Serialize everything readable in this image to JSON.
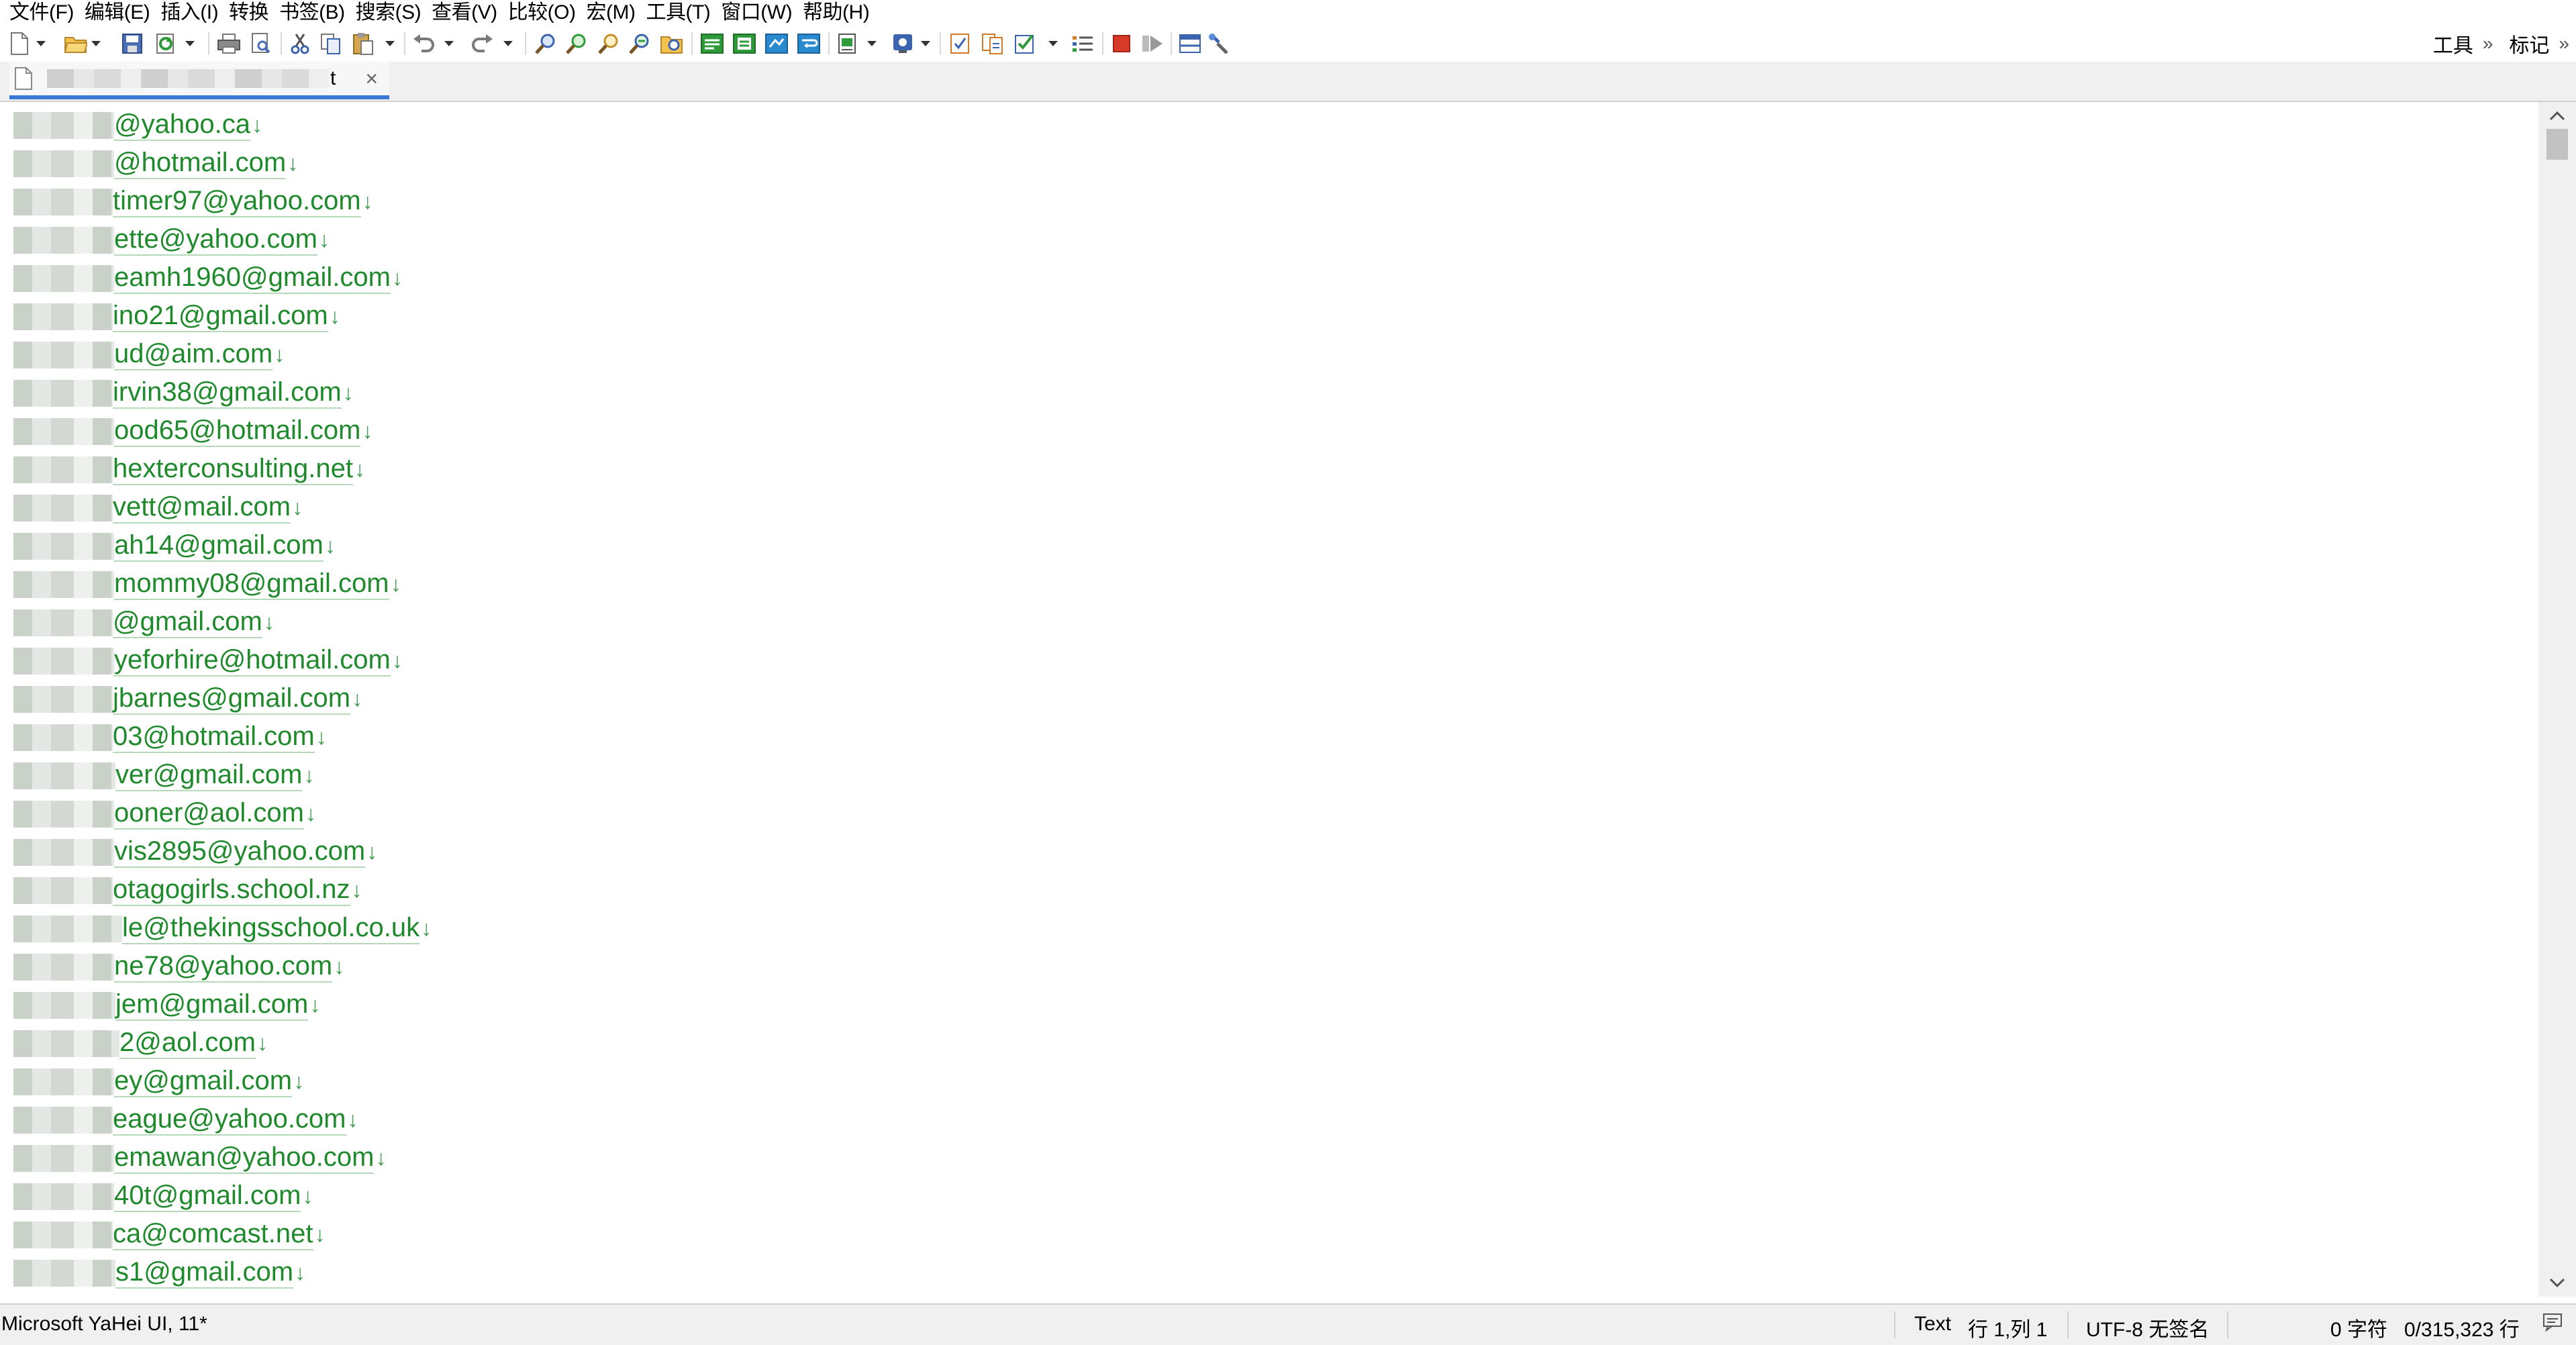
{
  "menu": [
    "文件(F)",
    "编辑(E)",
    "插入(I)",
    "转换",
    "书签(B)",
    "搜索(S)",
    "查看(V)",
    "比较(O)",
    "宏(M)",
    "工具(T)",
    "窗口(W)",
    "帮助(H)"
  ],
  "toolbar_right": {
    "tools_label": "工具",
    "marks_label": "标记",
    "overflow": "»"
  },
  "tab": {
    "label": "t",
    "close": "×"
  },
  "lines": [
    "@yahoo.ca",
    "@hotmail.com",
    "timer97@yahoo.com",
    "ette@yahoo.com",
    "eamh1960@gmail.com",
    "ino21@gmail.com",
    "ud@aim.com",
    "irvin38@gmail.com",
    "ood65@hotmail.com",
    "hexterconsulting.net",
    "vett@mail.com",
    "ah14@gmail.com",
    "mommy08@gmail.com",
    "@gmail.com",
    "yeforhire@hotmail.com",
    "jbarnes@gmail.com",
    "03@hotmail.com",
    "ver@gmail.com",
    "ooner@aol.com",
    "vis2895@yahoo.com",
    "otagogirls.school.nz",
    "le@thekingsschool.co.uk",
    "ne78@yahoo.com",
    "jem@gmail.com",
    "2@aol.com",
    "ey@gmail.com",
    "eague@yahoo.com",
    "emawan@yahoo.com",
    "40t@gmail.com",
    "ca@comcast.net",
    "s1@gmail.com"
  ],
  "eol_marker": "↓",
  "status": {
    "font": "Microsoft YaHei UI, 11*",
    "mode": "Text",
    "position": "行 1,列 1",
    "encoding": "UTF-8 无签名",
    "chars": "0 字符",
    "lines": "0/315,323 行"
  }
}
